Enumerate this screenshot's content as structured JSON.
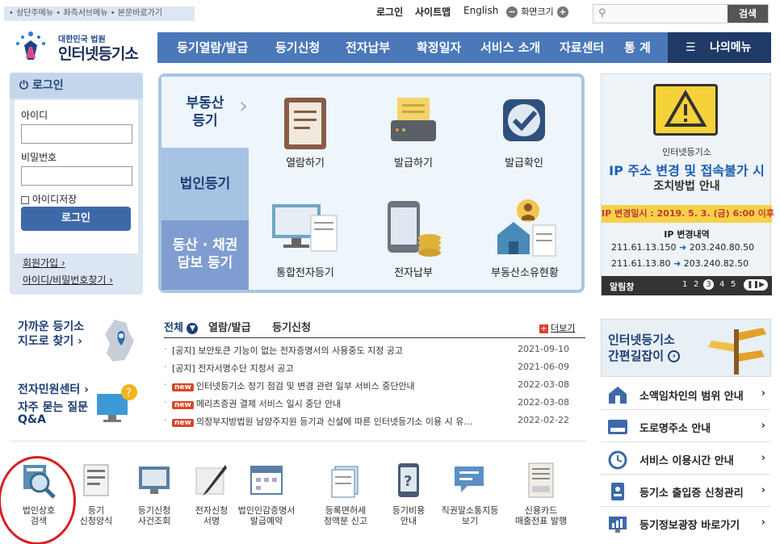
{
  "skip_links": "• 상단주메뉴 • 좌측서브메뉴 • 본문바로가기",
  "util": {
    "login": "로그인",
    "sitemap": "사이트맵",
    "english": "English",
    "zoom_label": "화면크기",
    "zoom_minus": "−",
    "zoom_plus": "+"
  },
  "search": {
    "placeholder": "",
    "button": "검색"
  },
  "logo": {
    "sub": "대한민국 법원",
    "title": "인터넷등기소"
  },
  "gnb": [
    "등기열람/발급",
    "등기신청",
    "전자납부",
    "확정일자",
    "서비스 소개",
    "자료센터",
    "통 계"
  ],
  "my_menu": "나의메뉴",
  "login_box": {
    "title": "로그인",
    "id_label": "아이디",
    "pw_label": "비밀번호",
    "save_id": "아이디저장",
    "button": "로그인",
    "join": "회원가입 ›",
    "find": "아이디/비밀번호찾기 ›"
  },
  "service_tabs": [
    "부동산\n등기",
    "법인등기",
    "동산 · 채권\n담보 등기"
  ],
  "service_items": [
    "열람하기",
    "발급하기",
    "발급확인",
    "통합전자등기",
    "전자납부",
    "부동산소유현황"
  ],
  "right_banner": {
    "org": "인터넷등기소",
    "headline": "IP 주소 변경 및 접속불가 시",
    "sub": "조치방법 안내",
    "date_line": "IP 변경일시 : 2019. 5. 3. (금) 6:00 이후",
    "history_title": "IP 변경내역",
    "rows": [
      {
        "from": "211.61.13.150",
        "to": "203.240.80.50"
      },
      {
        "from": "211.61.13.80",
        "to": "203.240.82.50"
      }
    ],
    "footer": "알림창",
    "pages": [
      "1",
      "2",
      "3",
      "4",
      "5"
    ],
    "current_page": "3"
  },
  "left_links": {
    "nearby": "가까운 등기소\n지도로 찾기 ›",
    "center": "전자민원센터 ›",
    "faq": "자주 묻는 질문",
    "qa": "Q&A"
  },
  "notice_tabs": {
    "all": "전체",
    "t1": "열람/발급",
    "t2": "등기신청",
    "more": "더보기"
  },
  "notices": [
    {
      "badge": "",
      "title": "[공지] 보안토큰 기능이 없는 전자증명서의 사용중도 지정 공고",
      "date": "2021-09-10"
    },
    {
      "badge": "",
      "title": "[공지] 전자서명수단 지정서 공고",
      "date": "2021-06-09"
    },
    {
      "badge": "new",
      "title": "인터넷등기소 정기 점검 및 변경 관련 일부 서비스 중단안내",
      "date": "2022-03-08"
    },
    {
      "badge": "new",
      "title": "메리츠증권 결제 서비스 일시 중단 안내",
      "date": "2022-03-08"
    },
    {
      "badge": "new",
      "title": "의정부지방법원 남양주지원 등기과 신설에 따른 인터넷등기소 이용 시 유…",
      "date": "2022-02-22"
    }
  ],
  "guide_banner": {
    "line1": "인터넷등기소",
    "line2": "간편길잡이"
  },
  "right_list": [
    "소액임차인의 범위 안내",
    "도로명주소 안내",
    "서비스 이용시간 안내",
    "등기소 출입증 신청관리",
    "등기정보광장 바로가기"
  ],
  "bottom_icons": [
    "법인상호\n검색",
    "등기\n신청양식",
    "등기신청\n사건조회",
    "전자신청\n서명",
    "법인인감증명서\n발급예약",
    "등록면허세\n정액분 신고",
    "등기비용\n안내",
    "직권말소통지등\n보기",
    "신용카드\n매출전표 발행"
  ],
  "colors": {
    "nav": "#4a78b9",
    "nav_dark": "#1f3a66",
    "accent_red": "#d62121",
    "headline_blue": "#1a5fb4"
  }
}
